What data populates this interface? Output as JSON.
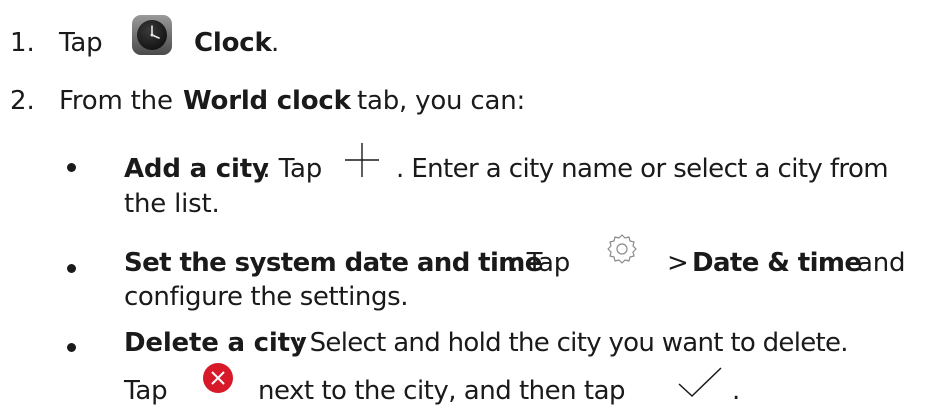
{
  "steps": [
    {
      "number": "1.",
      "prefix": "Tap",
      "icon": "clock-app-icon",
      "label": "Clock",
      "suffix": "."
    },
    {
      "number": "2.",
      "prefix": "From the",
      "tab": "World clock",
      "suffix": "tab, you can:"
    }
  ],
  "bullets": [
    {
      "title": "Add a city",
      "text1": ": Tap",
      "icon": "plus-icon",
      "text2": ". Enter a city name or select a city from",
      "text3": "the list."
    },
    {
      "title": "Set the system date and time",
      "text1": ": Tap",
      "icon": "gear-icon",
      "text2": ">",
      "bold2": "Date & time",
      "text3": "and",
      "text4": "configure the settings."
    },
    {
      "title": "Delete a city",
      "text1": ": Select and hold the city you want to delete.",
      "text2": "Tap",
      "icon": "delete-icon",
      "text3": "next to the city, and then tap",
      "icon2": "checkmark-icon",
      "text4": "."
    }
  ],
  "colors": {
    "text": "#1a1a1a",
    "delete_icon": "#d7192a",
    "icon_gray": "#9a9a9a"
  }
}
